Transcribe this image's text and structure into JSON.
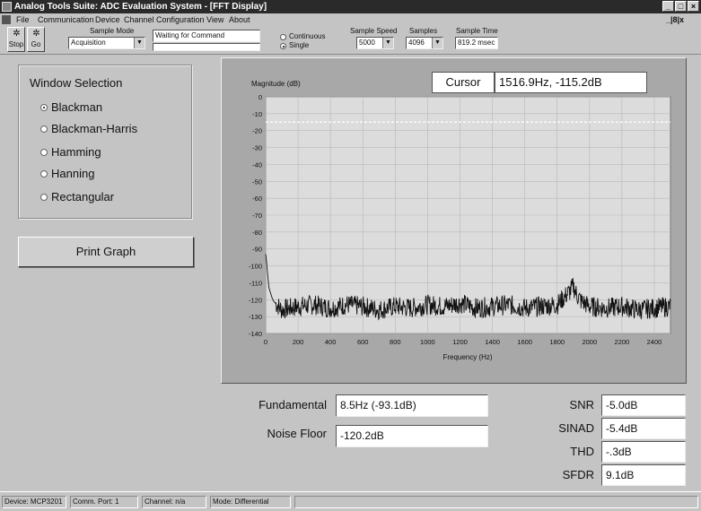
{
  "window": {
    "title": "Analog Tools Suite: ADC Evaluation System - [FFT Display]",
    "min_label": "_",
    "max_label": "□",
    "close_label": "×",
    "mdi_controls": "_|8|x"
  },
  "menu": {
    "items": [
      "File",
      "Communication",
      "Device",
      "Channel Configuration",
      "View",
      "About"
    ]
  },
  "toolbar": {
    "stop_label": "Stop",
    "go_label": "Go",
    "sample_mode_label": "Sample Mode",
    "sample_mode_value": "Acquisition",
    "command_status": "Waiting for Command",
    "radio_continuous": "Continuous",
    "radio_single": "Single",
    "sample_speed_label": "Sample Speed",
    "sample_speed_value": "5000",
    "samples_label": "Samples",
    "samples_value": "4096",
    "sample_time_label": "Sample Time",
    "sample_time_value": "819.2 msec"
  },
  "window_selection": {
    "title": "Window Selection",
    "options": [
      "Blackman",
      "Blackman-Harris",
      "Hamming",
      "Hanning",
      "Rectangular"
    ],
    "selected": "Blackman"
  },
  "print_button": "Print Graph",
  "cursor": {
    "label": "Cursor",
    "value": "1516.9Hz, -115.2dB"
  },
  "chart_data": {
    "type": "line",
    "title": "",
    "ylabel": "Magnitude (dB)",
    "xlabel": "Frequency (Hz)",
    "xlim": [
      0,
      2500
    ],
    "ylim": [
      -140,
      0
    ],
    "x_ticks": [
      0,
      200,
      400,
      600,
      800,
      1000,
      1200,
      1400,
      1600,
      1800,
      2000,
      2200,
      2400
    ],
    "y_ticks": [
      0,
      -10,
      -20,
      -30,
      -40,
      -50,
      -60,
      -70,
      -80,
      -90,
      -100,
      -110,
      -120,
      -130,
      -140
    ],
    "grid": true,
    "reference_line_db": -15,
    "series": [
      {
        "x": [
          0,
          5,
          10,
          15,
          20,
          30,
          40,
          50,
          60,
          80,
          100,
          150,
          200,
          300,
          400,
          500,
          600,
          700,
          800,
          900,
          1000,
          1100,
          1200,
          1300,
          1400,
          1500,
          1600,
          1700,
          1800,
          1850,
          1880,
          1900,
          1920,
          1950,
          2000,
          2100,
          2200,
          2300,
          2400,
          2500
        ],
        "y": [
          -93,
          -97,
          -103,
          -108,
          -113,
          -116,
          -119,
          -121,
          -122,
          -124,
          -126,
          -125,
          -124,
          -123,
          -125,
          -123,
          -124,
          -126,
          -124,
          -125,
          -123,
          -124,
          -122,
          -125,
          -124,
          -123,
          -125,
          -124,
          -123,
          -118,
          -115,
          -112,
          -117,
          -121,
          -124,
          -125,
          -124,
          -126,
          -125,
          -124
        ]
      }
    ]
  },
  "measurements": {
    "fundamental_label": "Fundamental",
    "fundamental_value": "8.5Hz (-93.1dB)",
    "noise_floor_label": "Noise Floor",
    "noise_floor_value": "-120.2dB",
    "snr_label": "SNR",
    "snr_value": "-5.0dB",
    "sinad_label": "SINAD",
    "sinad_value": "-5.4dB",
    "thd_label": "THD",
    "thd_value": "-.3dB",
    "sfdr_label": "SFDR",
    "sfdr_value": "9.1dB"
  },
  "status": {
    "device": "Device: MCP3201",
    "port": "Comm. Port: 1",
    "channel": "Channel: n/a",
    "mode": "Mode: Differential"
  },
  "icons": {
    "stop": "stop-icon",
    "go": "go-icon",
    "app": "app-icon"
  },
  "colors": {
    "chart_bg": "#dcdcdc",
    "chart_panel": "#a8a8a8",
    "trace": "#111111",
    "titlebar": "#2a2a2a"
  }
}
